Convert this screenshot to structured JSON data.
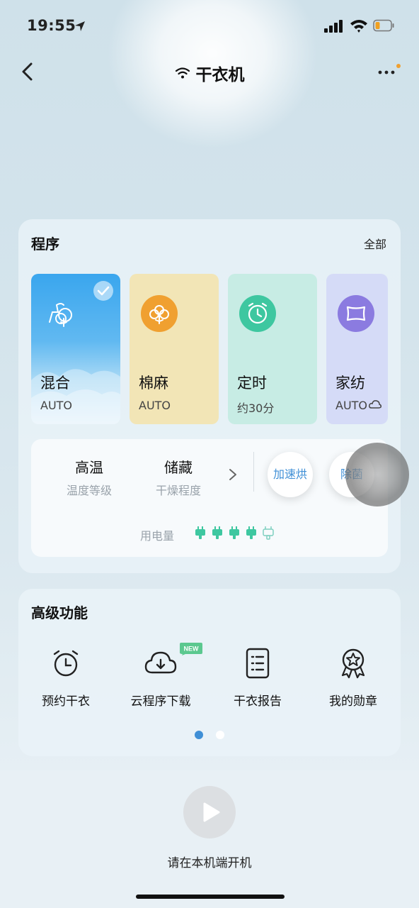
{
  "status_bar": {
    "time": "19:55"
  },
  "header": {
    "title": "干衣机"
  },
  "programs": {
    "title": "程序",
    "all_label": "全部",
    "items": [
      {
        "name": "混合",
        "sub": "AUTO",
        "selected": true,
        "icon": "mixed-clothes-icon",
        "color": "#3aa6ee"
      },
      {
        "name": "棉麻",
        "sub": "AUTO",
        "selected": false,
        "icon": "cotton-icon",
        "color": "#f0a030"
      },
      {
        "name": "定时",
        "sub": "约30分",
        "selected": false,
        "icon": "alarm-clock-icon",
        "color": "#3ec7a0"
      },
      {
        "name": "家纺",
        "sub": "AUTO",
        "selected": false,
        "icon": "pillow-icon",
        "color": "#8b7be0"
      }
    ],
    "options": [
      {
        "value": "高温",
        "label": "温度等级"
      },
      {
        "value": "储藏",
        "label": "干燥程度"
      }
    ],
    "pills": [
      "加速烘",
      "除菌"
    ],
    "electricity_label": "用电量",
    "electricity_level": 4,
    "electricity_max": 5
  },
  "advanced": {
    "title": "高级功能",
    "items": [
      {
        "label": "预约干衣",
        "icon": "alarm-clock-icon"
      },
      {
        "label": "云程序下载",
        "icon": "cloud-download-icon",
        "badge": "NEW"
      },
      {
        "label": "干衣报告",
        "icon": "report-icon"
      },
      {
        "label": "我的勋章",
        "icon": "medal-icon"
      }
    ],
    "page_index": 1,
    "page_count": 2
  },
  "bottom": {
    "hint": "请在本机端开机"
  },
  "colors": {
    "accent": "#3f8fd6",
    "plug": "#3ec7a0"
  }
}
